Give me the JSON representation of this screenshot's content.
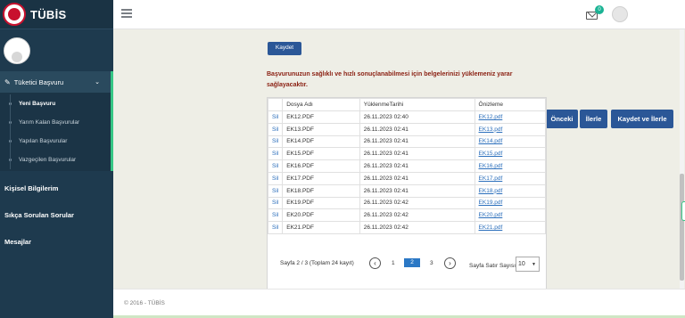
{
  "brand": {
    "name": "TÜBİS"
  },
  "sidebar": {
    "parent_label": "Tüketici Başvuru",
    "sub_items": [
      {
        "label": "Yeni Başvuru"
      },
      {
        "label": "Yarım Kalan Başvurular"
      },
      {
        "label": "Yapılan Başvurular"
      },
      {
        "label": "Vazgeçilen Başvurular"
      }
    ],
    "items": [
      {
        "label": "Kişisel Bilgilerim"
      },
      {
        "label": "Sıkça Sorulan Sorular"
      },
      {
        "label": "Mesajlar"
      }
    ]
  },
  "topbar": {
    "notification_count": "0"
  },
  "content": {
    "top_button_label": "Kaydet",
    "info_text": "Başvurunuzun sağlıklı ve hızlı sonuçlanabilmesi için belgelerinizi yüklemeniz yarar sağlayacaktır.",
    "buttons": {
      "prev": "Önceki",
      "next": "İlerle",
      "save_next": "Kaydet ve İlerle"
    }
  },
  "table": {
    "headers": {
      "action": "",
      "name": "Dosya Adı",
      "date": "YüklenmeTarihi",
      "preview": "Önizleme"
    },
    "rows": [
      {
        "action": "Sil",
        "name": "EK12.PDF",
        "date": "26.11.2023 02:40",
        "preview": "EK12.pdf"
      },
      {
        "action": "Sil",
        "name": "EK13.PDF",
        "date": "26.11.2023 02:41",
        "preview": "EK13.pdf"
      },
      {
        "action": "Sil",
        "name": "EK14.PDF",
        "date": "26.11.2023 02:41",
        "preview": "EK14.pdf"
      },
      {
        "action": "Sil",
        "name": "EK15.PDF",
        "date": "26.11.2023 02:41",
        "preview": "EK15.pdf"
      },
      {
        "action": "Sil",
        "name": "EK16.PDF",
        "date": "26.11.2023 02:41",
        "preview": "EK16.pdf"
      },
      {
        "action": "Sil",
        "name": "EK17.PDF",
        "date": "26.11.2023 02:41",
        "preview": "EK17.pdf"
      },
      {
        "action": "Sil",
        "name": "EK18.PDF",
        "date": "26.11.2023 02:41",
        "preview": "EK18.pdf"
      },
      {
        "action": "Sil",
        "name": "EK19.PDF",
        "date": "26.11.2023 02:42",
        "preview": "EK19.pdf"
      },
      {
        "action": "Sil",
        "name": "EK20.PDF",
        "date": "26.11.2023 02:42",
        "preview": "EK20.pdf"
      },
      {
        "action": "Sil",
        "name": "EK21.PDF",
        "date": "26.11.2023 02:42",
        "preview": "EK21.pdf"
      }
    ]
  },
  "pager": {
    "summary": "Sayfa 2 / 3 (Toplam 24 kayıt)",
    "pages": [
      "1",
      "2",
      "3"
    ],
    "current_page": "2",
    "rows_label": "Sayfa Satır Sayısı",
    "rows_value": "10"
  },
  "footer": {
    "text": "© 2016 - TÜBİS"
  }
}
